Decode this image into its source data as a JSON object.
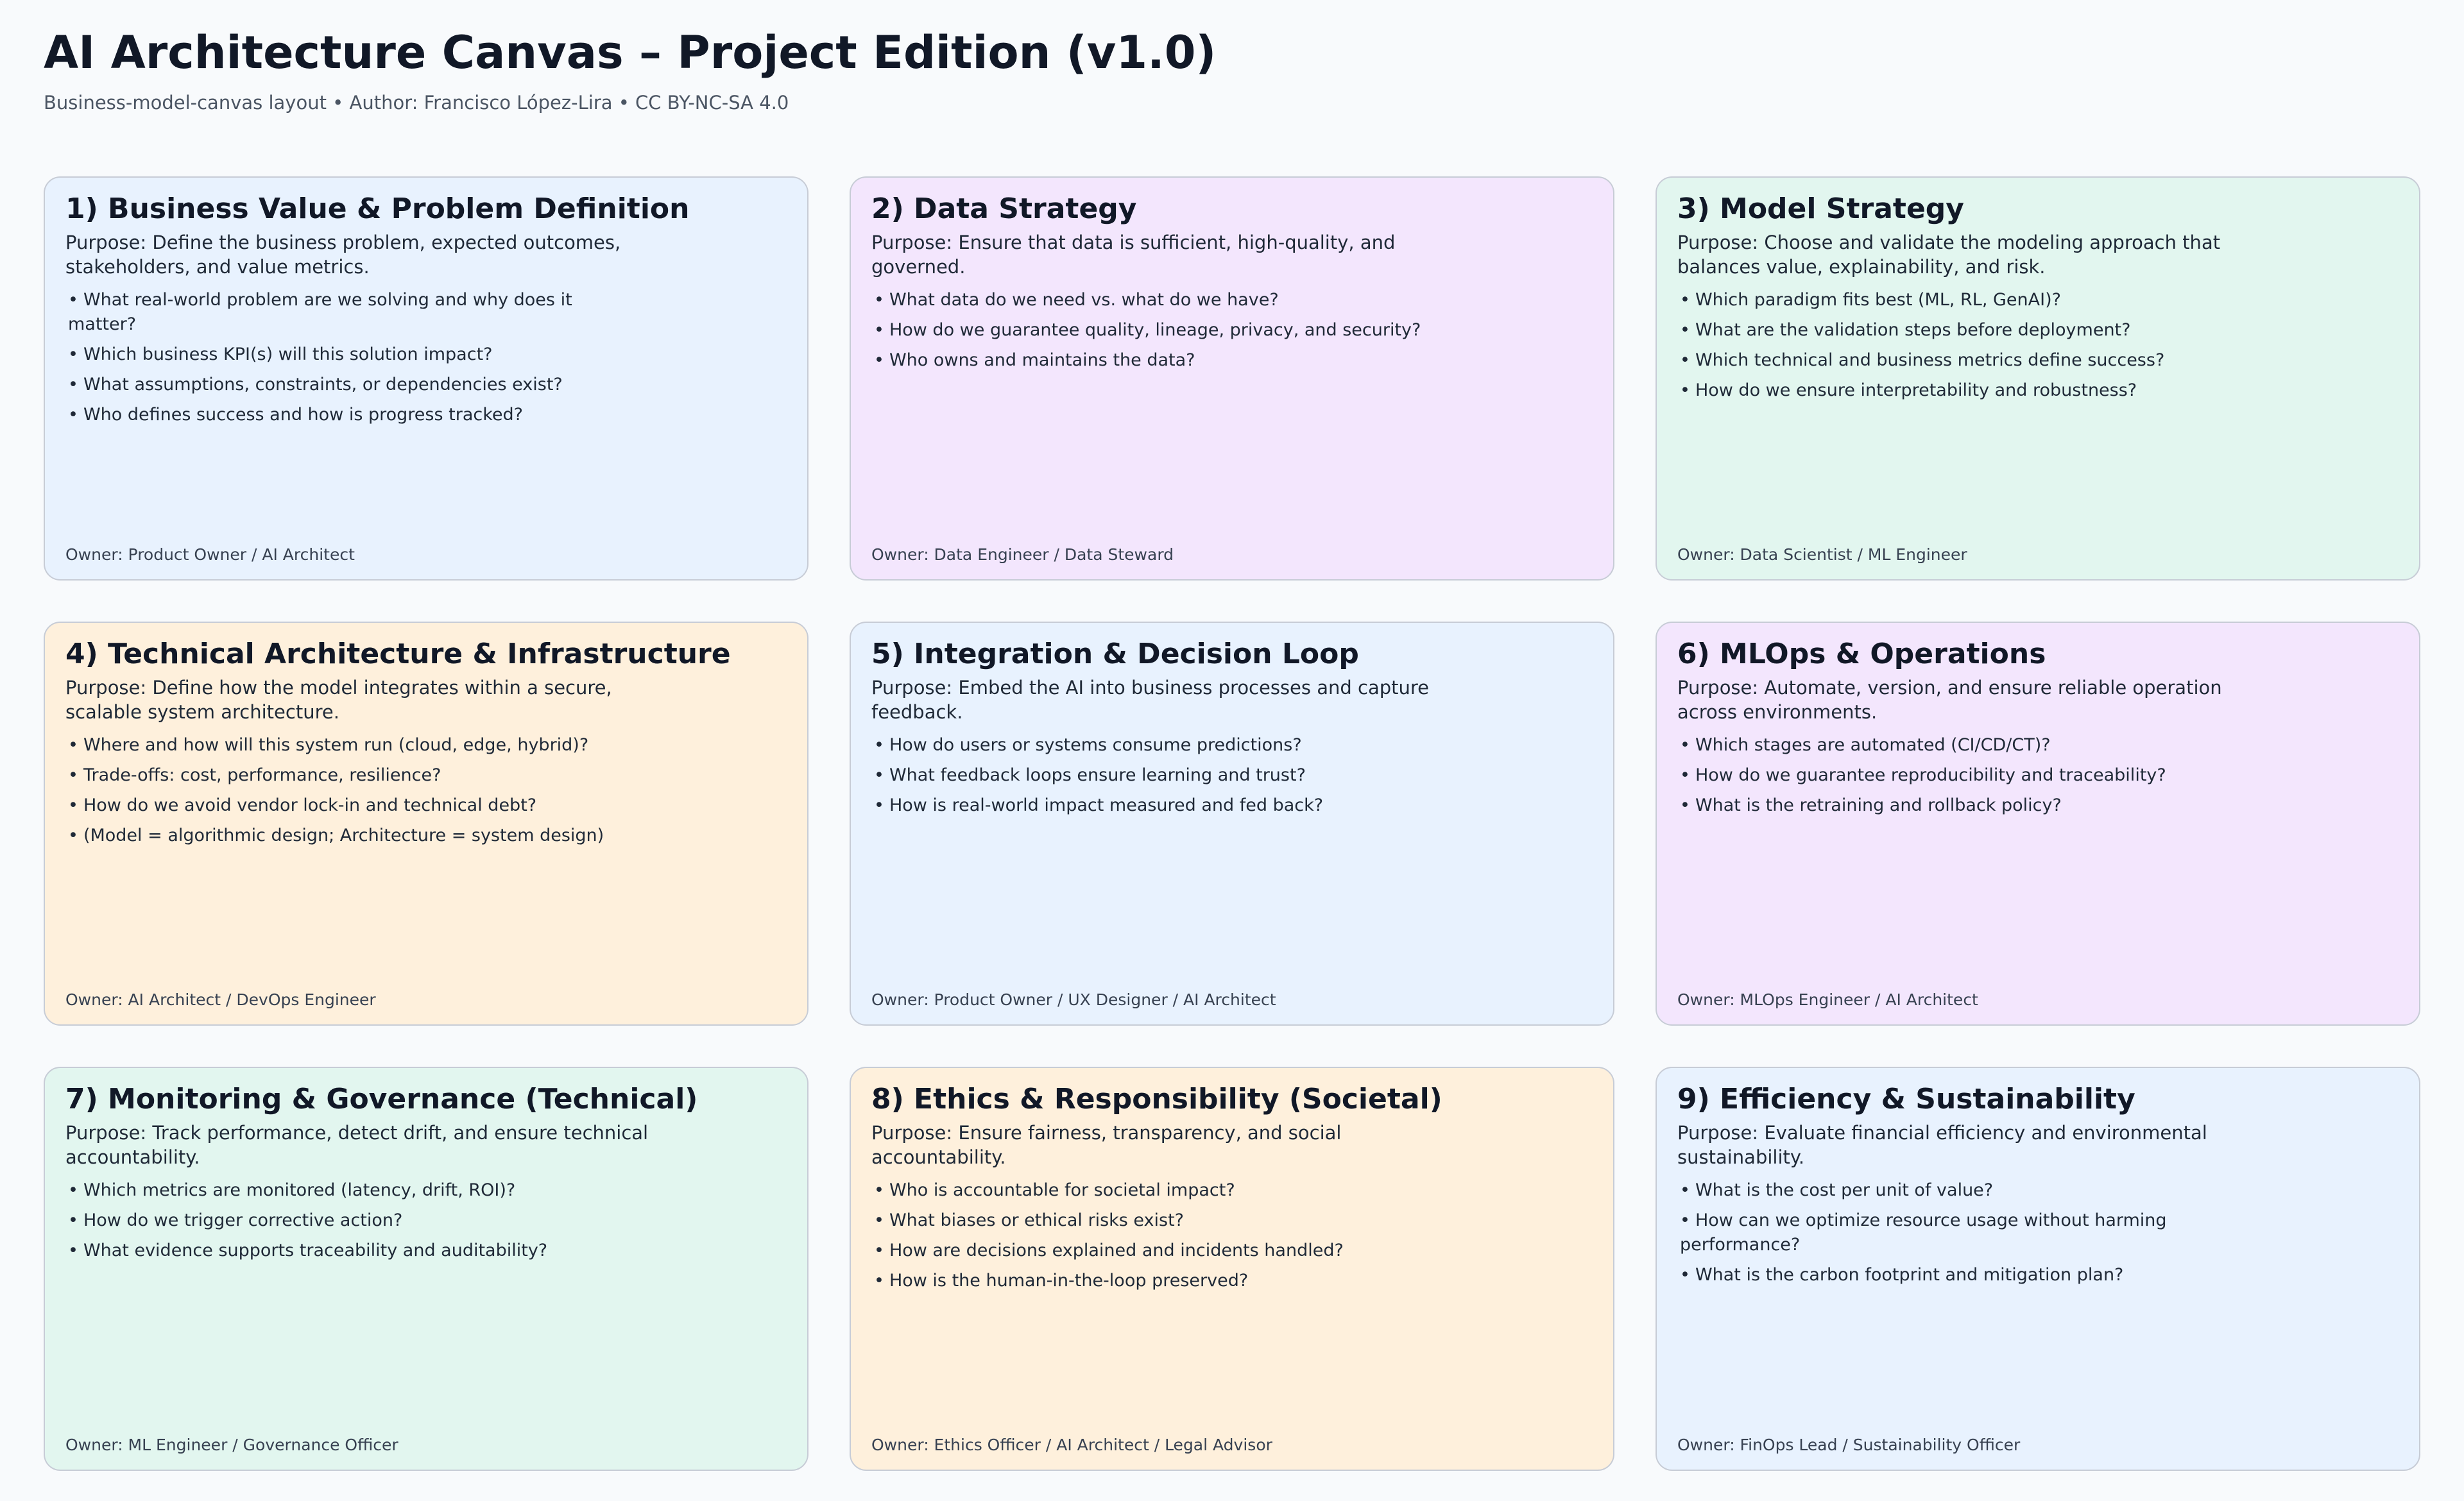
{
  "header": {
    "title": "AI Architecture Canvas – Project Edition (v1.0)",
    "subtitle": "Business-model-canvas layout • Author: Francisco López-Lira • CC BY-NC-SA 4.0"
  },
  "colors": {
    "background": "#f8fafc",
    "card_blue": "#e8f2fe",
    "card_purple": "#f3e6fd",
    "card_green": "#e2f6ef",
    "card_orange": "#fef0dc",
    "card_border": "#c7ccd6"
  },
  "bullet_glyph": "•",
  "cards": [
    {
      "title": "1) Business Value & Problem Definition",
      "purpose": "Purpose: Define the business problem, expected outcomes, stakeholders, and value metrics.",
      "questions": [
        "What real-world problem are we solving and why does it matter?",
        "Which business KPI(s) will this solution impact?",
        "What assumptions, constraints, or dependencies exist?",
        "Who defines success and how is progress tracked?"
      ],
      "owner": "Owner: Product Owner / AI Architect",
      "color": "#e8f2fe"
    },
    {
      "title": "2) Data Strategy",
      "purpose": "Purpose: Ensure that data is sufficient, high-quality, and governed.",
      "questions": [
        "What data do we need vs. what do we have?",
        "How do we guarantee quality, lineage, privacy, and security?",
        "Who owns and maintains the data?"
      ],
      "owner": "Owner: Data Engineer / Data Steward",
      "color": "#f3e6fd"
    },
    {
      "title": "3) Model Strategy",
      "purpose": "Purpose: Choose and validate the modeling approach that balances value, explainability, and risk.",
      "questions": [
        "Which paradigm fits best (ML, RL, GenAI)?",
        "What are the validation steps before deployment?",
        "Which technical and business metrics define success?",
        "How do we ensure interpretability and robustness?"
      ],
      "owner": "Owner: Data Scientist / ML Engineer",
      "color": "#e2f6ef"
    },
    {
      "title": "4) Technical Architecture & Infrastructure",
      "purpose": "Purpose: Define how the model integrates within a secure, scalable system architecture.",
      "questions": [
        "Where and how will this system run (cloud, edge, hybrid)?",
        "Trade-offs: cost, performance, resilience?",
        "How do we avoid vendor lock-in and technical debt?",
        "(Model = algorithmic design; Architecture = system design)"
      ],
      "owner": "Owner: AI Architect / DevOps Engineer",
      "color": "#fef0dc"
    },
    {
      "title": "5) Integration & Decision Loop",
      "purpose": "Purpose: Embed the AI into business processes and capture feedback.",
      "questions": [
        "How do users or systems consume predictions?",
        "What feedback loops ensure learning and trust?",
        "How is real-world impact measured and fed back?"
      ],
      "owner": "Owner: Product Owner / UX Designer / AI Architect",
      "color": "#e8f2fe"
    },
    {
      "title": "6) MLOps & Operations",
      "purpose": "Purpose: Automate, version, and ensure reliable operation across environments.",
      "questions": [
        "Which stages are automated (CI/CD/CT)?",
        "How do we guarantee reproducibility and traceability?",
        "What is the retraining and rollback policy?"
      ],
      "owner": "Owner: MLOps Engineer / AI Architect",
      "color": "#f3e6fd"
    },
    {
      "title": "7) Monitoring & Governance (Technical)",
      "purpose": "Purpose: Track performance, detect drift, and ensure technical accountability.",
      "questions": [
        "Which metrics are monitored (latency, drift, ROI)?",
        "How do we trigger corrective action?",
        "What evidence supports traceability and auditability?"
      ],
      "owner": "Owner: ML Engineer / Governance Officer",
      "color": "#e2f6ef"
    },
    {
      "title": "8) Ethics & Responsibility (Societal)",
      "purpose": "Purpose: Ensure fairness, transparency, and social accountability.",
      "questions": [
        "Who is accountable for societal impact?",
        "What biases or ethical risks exist?",
        "How are decisions explained and incidents handled?",
        "How is the human-in-the-loop preserved?"
      ],
      "owner": "Owner: Ethics Officer / AI Architect / Legal Advisor",
      "color": "#fef0dc"
    },
    {
      "title": "9) Efficiency & Sustainability",
      "purpose": "Purpose: Evaluate financial efficiency and environmental sustainability.",
      "questions": [
        "What is the cost per unit of value?",
        "How can we optimize resource usage without harming performance?",
        "What is the carbon footprint and mitigation plan?"
      ],
      "owner": "Owner: FinOps Lead / Sustainability Officer",
      "color": "#e8f2fe"
    }
  ]
}
